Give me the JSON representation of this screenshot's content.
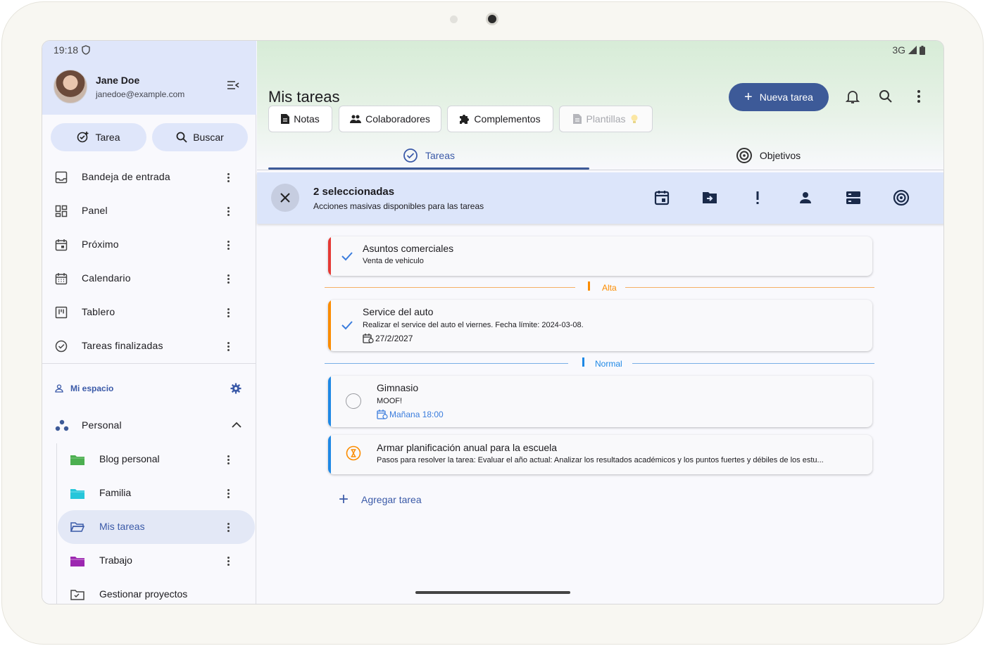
{
  "status": {
    "time": "19:18",
    "network": "3G"
  },
  "user": {
    "name": "Jane Doe",
    "email": "janedoe@example.com"
  },
  "sidebar": {
    "task_button": "Tarea",
    "search_button": "Buscar",
    "nav": [
      {
        "label": "Bandeja de entrada",
        "icon": "inbox-icon"
      },
      {
        "label": "Panel",
        "icon": "dashboard-icon"
      },
      {
        "label": "Próximo",
        "icon": "upcoming-icon"
      },
      {
        "label": "Calendario",
        "icon": "calendar-icon"
      },
      {
        "label": "Tablero",
        "icon": "board-icon"
      },
      {
        "label": "Tareas finalizadas",
        "icon": "check-circle-icon"
      }
    ],
    "space_label": "Mi espacio",
    "group_label": "Personal",
    "projects": [
      {
        "label": "Blog personal",
        "color": "#4caf50"
      },
      {
        "label": "Familia",
        "color": "#26c6da"
      },
      {
        "label": "Mis tareas",
        "color": "#3b5aa8"
      },
      {
        "label": "Trabajo",
        "color": "#9c27b0"
      },
      {
        "label": "Gestionar proyectos",
        "color": "#444444"
      }
    ]
  },
  "main": {
    "title": "Mis tareas",
    "new_task": "Nueva tarea",
    "chips": [
      "Notas",
      "Colaboradores",
      "Complementos",
      "Plantillas"
    ],
    "tabs": [
      "Tareas",
      "Objetivos"
    ],
    "selection": {
      "title": "2 seleccionadas",
      "subtitle": "Acciones masivas disponibles para las tareas"
    },
    "tasks": [
      {
        "title": "Asuntos comerciales",
        "desc": "Venta de vehiculo",
        "color": "#e53935"
      },
      {
        "title": "Service del auto",
        "desc": "Realizar el service del auto el viernes. Fecha límite: 2024-03-08.",
        "date": "27/2/2027",
        "color": "#fb8c00"
      },
      {
        "title": "Gimnasio",
        "desc": "MOOF!",
        "date": "Mañana 18:00",
        "color": "#1e88e5"
      },
      {
        "title": "Armar planificación anual para la escuela",
        "desc": "Pasos para resolver la tarea: Evaluar el año actual: Analizar los resultados académicos y los puntos fuertes y débiles de los estu...",
        "color": "#1e88e5"
      }
    ],
    "sections": {
      "high": "Alta",
      "normal": "Normal"
    },
    "add_task": "Agregar tarea"
  },
  "colors": {
    "accent": "#3d5a98",
    "high": "#fb8c00",
    "normal": "#1e88e5",
    "urgent": "#e53935"
  }
}
